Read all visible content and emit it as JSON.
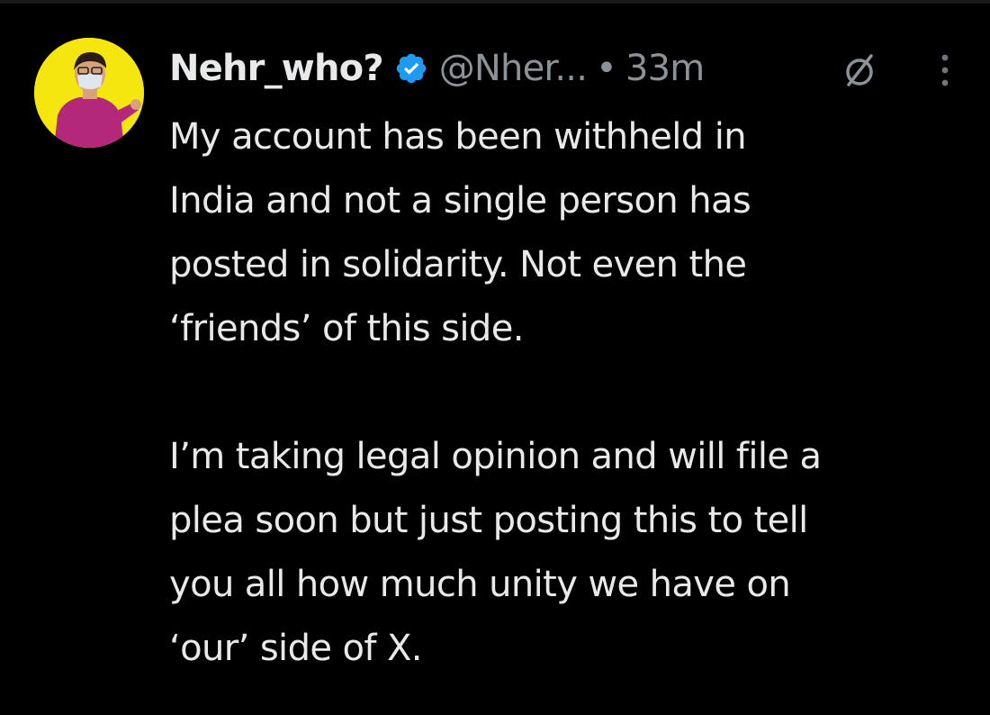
{
  "tweet": {
    "author": {
      "display_name": "Nehr_who?",
      "handle": "@Nher...",
      "verified": true,
      "verified_icon": "verified-badge-icon",
      "avatar_background": "#f5e60f"
    },
    "separator": "•",
    "time": "33m",
    "actions": {
      "grok_icon": "slashed-circle-icon",
      "more_icon": "more-vertical-icon"
    },
    "body": {
      "paragraph_1_lines": [
        "My account has been withheld in",
        "India and not a single person has",
        "posted in solidarity. Not even the",
        "‘friends’ of this side."
      ],
      "paragraph_2_lines": [
        "I’m taking legal opinion and will file a",
        "plea soon but just posting this to tell",
        "you all how much unity we have on",
        "‘our’ side of X."
      ]
    }
  },
  "colors": {
    "background": "#000000",
    "text_primary": "#e7e9ea",
    "text_secondary": "#8b9298",
    "verified_blue": "#1d9bf0"
  }
}
